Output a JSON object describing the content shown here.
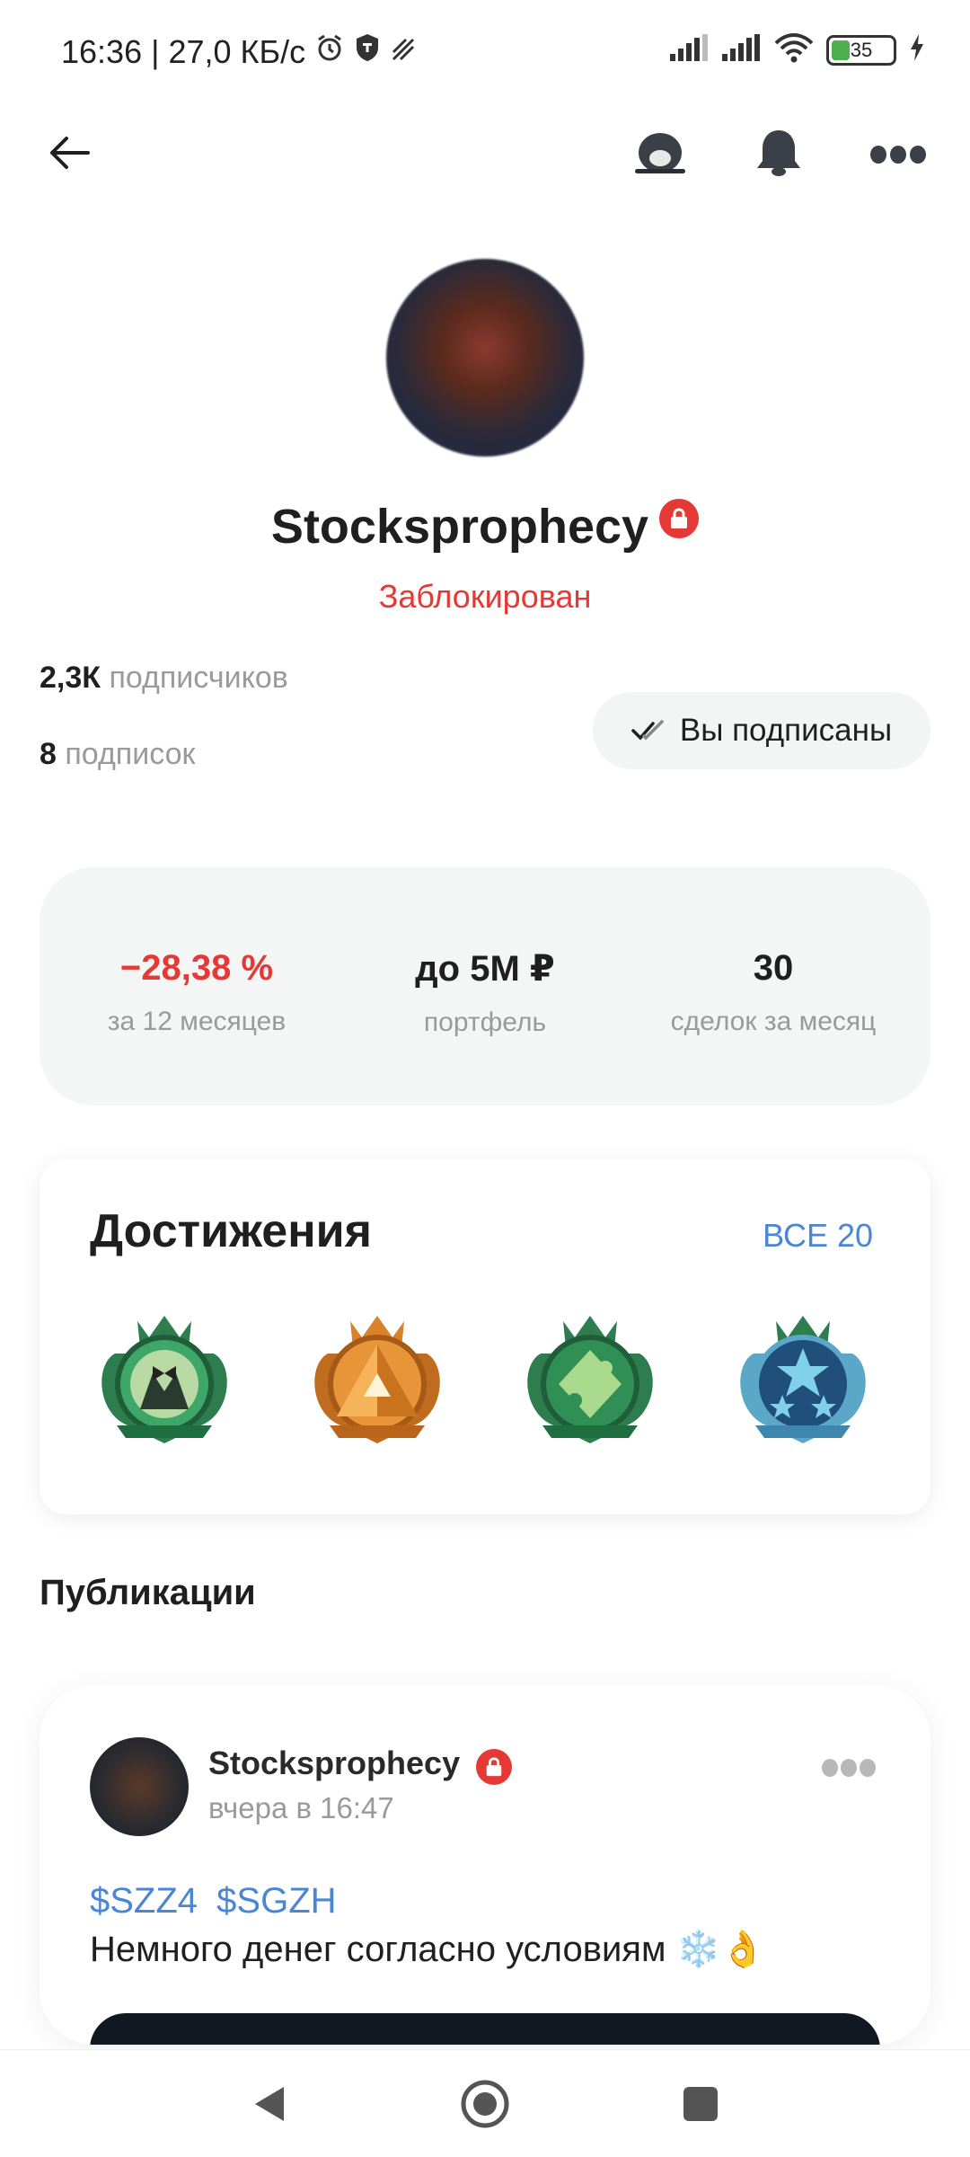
{
  "status_bar": {
    "time_speed": "16:36 | 27,0 КБ/с",
    "battery": "35"
  },
  "profile": {
    "name": "Stocksprophecy",
    "status": "Заблокирован",
    "followers_count": "2,3К",
    "followers_label": "подписчиков",
    "following_count": "8",
    "following_label": "подписок",
    "subscribe_state": "Вы подписаны"
  },
  "stats": [
    {
      "value": "−28,38 %",
      "label": "за 12 месяцев",
      "negative": true
    },
    {
      "value": "до 5М ₽",
      "label": "портфель"
    },
    {
      "value": "30",
      "label": "сделок за месяц"
    }
  ],
  "achievements": {
    "title": "Достижения",
    "all_label": "ВСЕ 20",
    "badges": [
      {
        "icon": "tuxedo-badge-icon",
        "color": "#2e8b57"
      },
      {
        "icon": "pyramid-badge-icon",
        "color": "#d9822b"
      },
      {
        "icon": "puzzle-badge-icon",
        "color": "#2e8b57"
      },
      {
        "icon": "stars-badge-icon",
        "color": "#2f6f9f"
      }
    ]
  },
  "publications": {
    "title": "Публикации",
    "post": {
      "author": "Stocksprophecy",
      "time": "вчера в 16:47",
      "tags": [
        "$SZZ4",
        "$SGZH"
      ],
      "text": "Немного денег согласно условиям ❄️👌"
    }
  },
  "colors": {
    "negative": "#e53935",
    "link": "#4a86d4",
    "muted": "#9a9a9a"
  }
}
